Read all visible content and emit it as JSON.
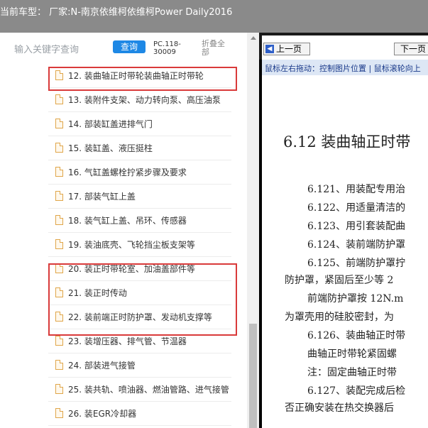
{
  "header": {
    "title": "当前车型：  厂家:N-南京依维柯依维柯Power Daily2016"
  },
  "search": {
    "placeholder": "输入关键字查询",
    "button_label": "查询",
    "code": "PC.118-30009",
    "collapse_label": "折叠全部"
  },
  "tree": {
    "items": [
      {
        "label": "12. 装曲轴正时带轮装曲轴正时带轮"
      },
      {
        "label": "13. 装附件支架、动力转向泵、高压油泵"
      },
      {
        "label": "14. 部装缸盖进排气门"
      },
      {
        "label": "15. 装缸盖、液压挺柱"
      },
      {
        "label": "16. 气缸盖螺栓拧紧步骤及要求"
      },
      {
        "label": "17. 部装气缸上盖"
      },
      {
        "label": "18. 装气缸上盖、吊环、传感器"
      },
      {
        "label": "19. 装油底壳、飞轮挡尘板支架等"
      },
      {
        "label": "20. 装正时带轮室、加油盖部件等"
      },
      {
        "label": "21. 装正时传动"
      },
      {
        "label": "22. 装前端正时防护罩、发动机支撑等"
      },
      {
        "label": "23. 装增压器、排气管、节温器"
      },
      {
        "label": "24. 部装进气接管"
      },
      {
        "label": "25. 装共轨、喷油器、燃油管路、进气接管"
      },
      {
        "label": "26. 装EGR冷却器"
      }
    ]
  },
  "viewer": {
    "prev_label": "上一页",
    "prev_arrow": "◀",
    "next_label": "下一页",
    "hint": "鼠标左右拖动：控制图片位置 | 鼠标滚轮向上",
    "heading": "6.12  装曲轴正时带",
    "lines": [
      "6.121、用装配专用治",
      "6.122、用适量清洁的",
      "6.123、用引套装配曲",
      "6.124、装前端防护罩",
      "6.125、前端防护罩拧",
      "防护罩，紧固后至少等 2",
      "前端防护罩按 12N.m",
      "为罩壳用的硅胶密封，为",
      "6.126、装曲轴正时带",
      "曲轴正时带轮紧固螺",
      "注：固定曲轴正时带",
      "6.127、装配完成后检",
      "否正确安装在热交换器后"
    ]
  },
  "colors": {
    "header_bg": "#8a8a8a",
    "accent": "#1e88e5",
    "highlight": "#d93a3a"
  }
}
